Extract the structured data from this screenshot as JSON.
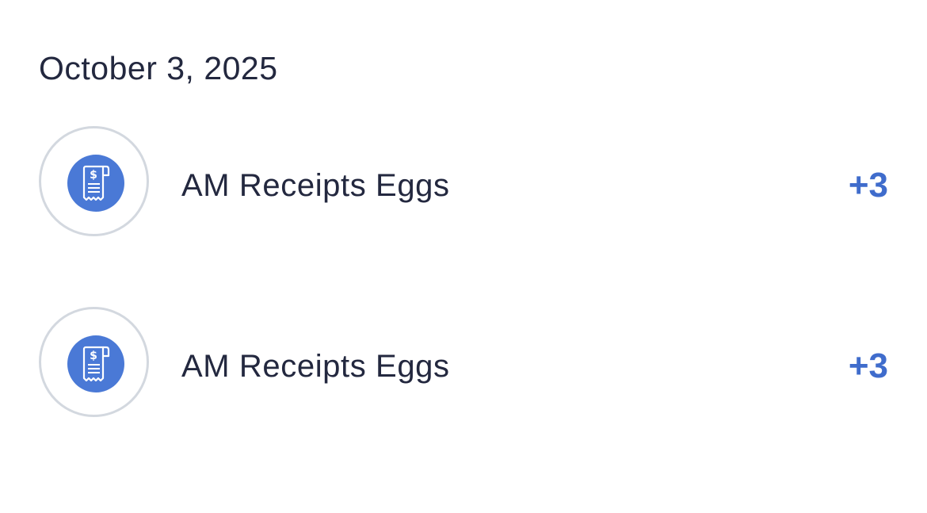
{
  "section": {
    "date": "October 3, 2025"
  },
  "activities": [
    {
      "title": "AM Receipts Eggs",
      "points": "+3",
      "icon": "receipt-dollar-icon"
    },
    {
      "title": "AM Receipts Eggs",
      "points": "+3",
      "icon": "receipt-dollar-icon"
    }
  ],
  "colors": {
    "accent": "#3f6ccc",
    "badge": "#4a79d6",
    "text": "#23283f",
    "ring": "#d3d8df"
  }
}
